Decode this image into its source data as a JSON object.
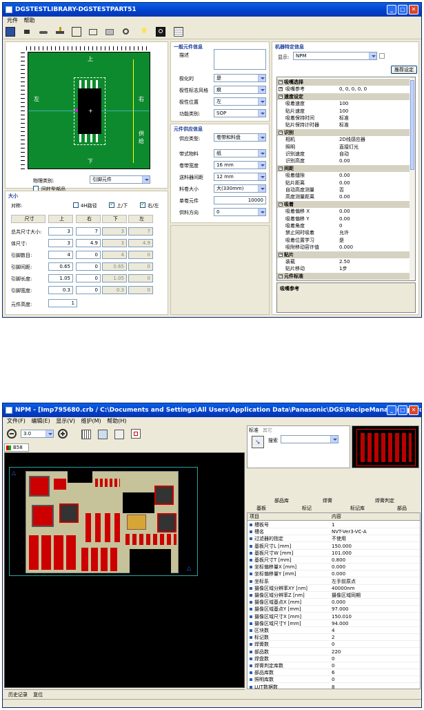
{
  "win1": {
    "title": "DGSTESTLIBRARY-DGSTESTPART51",
    "menu": [
      "元件",
      "帮助"
    ],
    "toolbar_icons": [
      "save-icon",
      "component-icon",
      "chip-icon",
      "pick-icon",
      "tray-icon",
      "feeder-icon",
      "nozzle-icon",
      "camera-icon",
      "light-icon",
      "zoom-icon",
      "grid-icon"
    ],
    "preview": {
      "top": "上",
      "bottom": "下",
      "left": "左",
      "right": "右",
      "feed": "供给"
    },
    "shape_type_label": "物理类别:",
    "shape_type_value": "引脚元件",
    "polarized_label": "回柱型部品",
    "size": {
      "section": "大小",
      "object_label": "对称:",
      "four_leads": "4H路径",
      "updown": "上/下",
      "leftright": "右/左",
      "col_headers": [
        "尺寸",
        "上",
        "右",
        "下",
        "左"
      ],
      "rows": [
        {
          "label": "总共尺寸大小:",
          "vals": [
            "3",
            "7",
            "3",
            "7"
          ]
        },
        {
          "label": "体尺寸:",
          "vals": [
            "3",
            "4.9",
            "3",
            "4.9"
          ]
        },
        {
          "label": "引脚数目:",
          "vals": [
            "4",
            "0",
            "4",
            "0"
          ]
        },
        {
          "label": "引脚间距:",
          "vals": [
            "0.65",
            "0",
            "0.65",
            "0"
          ]
        },
        {
          "label": "引脚长度:",
          "vals": [
            "1.05",
            "0",
            "1.05",
            "0"
          ]
        },
        {
          "label": "引脚宽度:",
          "vals": [
            "0.3",
            "0",
            "0.3",
            "0"
          ]
        }
      ],
      "height_label": "元件高度:",
      "height_value": "1"
    },
    "general": {
      "section": "一般元件信息",
      "desc_label": "描述",
      "rows": [
        {
          "label": "极化的",
          "value": "是"
        },
        {
          "label": "极性标志风格",
          "value": "痕"
        },
        {
          "label": "极性位置",
          "value": "左"
        },
        {
          "label": "功能类别:",
          "value": "SOP"
        }
      ]
    },
    "supply": {
      "section": "元件供应信息",
      "type_label": "供应类型:",
      "type_value": "卷带和料盘",
      "rows": [
        {
          "label": "带式物料",
          "value": "纸"
        },
        {
          "label": "卷带宽度",
          "value": "16 mm"
        },
        {
          "label": "送料器间距",
          "value": "12 mm"
        },
        {
          "label": "料卷大小",
          "value": "大(330mm)"
        },
        {
          "label": "单卷元件",
          "value": "10000"
        },
        {
          "label": "供料方向",
          "value": "0"
        }
      ]
    },
    "machine": {
      "section": "机器特定信息",
      "display_label": "显示:",
      "display_value": "NPM",
      "recommend_btn": "推荐设定",
      "props": [
        {
          "cat": true,
          "k": "吸嘴选择"
        },
        {
          "k": "吸嘴参考",
          "v": "0, 0, 0, 0, 0",
          "plus": true
        },
        {
          "cat": true,
          "k": "速度设定"
        },
        {
          "k": "吸着速度",
          "v": "100"
        },
        {
          "k": "贴片速度",
          "v": "100"
        },
        {
          "k": "吸着保持时间",
          "v": "标准"
        },
        {
          "k": "贴片保持计时器",
          "v": "标准"
        },
        {
          "cat": true,
          "k": "识别"
        },
        {
          "k": "相机",
          "v": "2D线感应器"
        },
        {
          "k": "照明",
          "v": "直接灯光"
        },
        {
          "k": "识别速度",
          "v": "自动"
        },
        {
          "k": "识别高度",
          "v": "0.00"
        },
        {
          "cat": true,
          "k": "间距"
        },
        {
          "k": "吸着缝隙",
          "v": "0.00"
        },
        {
          "k": "贴片距离",
          "v": "0.00"
        },
        {
          "k": "自动高度测量",
          "v": "否"
        },
        {
          "k": "高度测量距离",
          "v": "0.00"
        },
        {
          "cat": true,
          "k": "吸着"
        },
        {
          "k": "吸着偏移 X",
          "v": "0.00"
        },
        {
          "k": "吸着偏移 Y",
          "v": "0.00"
        },
        {
          "k": "吸着角度",
          "v": "0"
        },
        {
          "k": "禁止同时吸着",
          "v": "允许"
        },
        {
          "k": "吸着位置学习",
          "v": "是"
        },
        {
          "k": "吸附移动容许值",
          "v": "0.000"
        },
        {
          "cat": true,
          "k": "贴片"
        },
        {
          "k": "装载",
          "v": "2.50"
        },
        {
          "k": "贴片移动",
          "v": "1步"
        },
        {
          "cat": true,
          "k": "元件标准"
        }
      ],
      "desc_title": "吸嘴参考"
    }
  },
  "win2": {
    "title": "NPM - [Imp795680.crb / C:\\Documents and Settings\\All Users\\Application Data\\Panasonic\\DGS\\RecipeManager\\Upgrade Recipe260935_",
    "menu": [
      "文件(F)",
      "编辑(E)",
      "显示(V)",
      "维护(M)",
      "帮助(H)"
    ],
    "zoom_value": "3.0",
    "layer_tab": "B58",
    "std_tab": "标准",
    "other_tab": "其它",
    "search_label": "搜索",
    "tabs_row1": [
      "部品库",
      "焊膏",
      "焊膏判定"
    ],
    "tabs_row2": [
      "基板",
      "标记",
      "标记库",
      "部品"
    ],
    "table_headers": [
      "项目",
      "内容"
    ],
    "table_rows": [
      {
        "k": "槽板号",
        "v": "1"
      },
      {
        "k": "槽名",
        "v": "NVT-Ver3-VC-A"
      },
      {
        "k": "过滤器的指定",
        "v": "不使用"
      },
      {
        "k": "基板尺寸L [mm]",
        "v": "150.000"
      },
      {
        "k": "基板尺寸W [mm]",
        "v": "101.000"
      },
      {
        "k": "基板尺寸T [mm]",
        "v": "0.800"
      },
      {
        "k": "坐标偏移量X [mm]",
        "v": "0.000"
      },
      {
        "k": "坐标偏移量Y [mm]",
        "v": "0.000"
      },
      {
        "k": "坐标系",
        "v": "左手前原点"
      },
      {
        "k": "摄像区域分辨率XY [nm]",
        "v": "40000nm"
      },
      {
        "k": "摄像区域分辨率Z [nm]",
        "v": "摄像区域同期"
      },
      {
        "k": "摄像区域基点X [mm]",
        "v": "0.000"
      },
      {
        "k": "摄像区域基点Y [mm]",
        "v": "97.000"
      },
      {
        "k": "摄像区域尺寸X [mm]",
        "v": "150.010"
      },
      {
        "k": "摄像区域尺寸Y [mm]",
        "v": "94.000"
      },
      {
        "k": "区块数",
        "v": "4"
      },
      {
        "k": "标记数",
        "v": "2"
      },
      {
        "k": "焊膏数",
        "v": "0"
      },
      {
        "k": "部品数",
        "v": "220"
      },
      {
        "k": "焊盘数",
        "v": "0"
      },
      {
        "k": "焊膏判定库数",
        "v": "0"
      },
      {
        "k": "部品库数",
        "v": "6"
      },
      {
        "k": "照明库数",
        "v": "0"
      },
      {
        "k": "LUT数据数",
        "v": "8"
      }
    ],
    "bottom_tabs": [
      "历史记录",
      "复位"
    ]
  }
}
